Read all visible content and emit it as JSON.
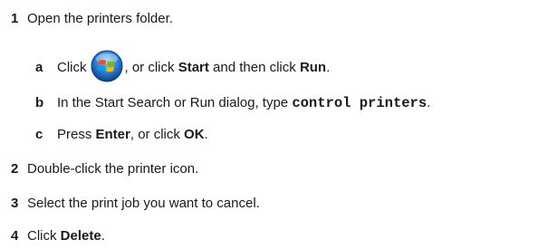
{
  "steps": [
    {
      "number": "1",
      "text": "Open the printers folder."
    },
    {
      "number": "2",
      "text": "Double-click the printer icon."
    },
    {
      "number": "3",
      "text": "Select the print job you want to cancel."
    },
    {
      "number": "4",
      "pre": "Click ",
      "bold": "Delete",
      "post": "."
    }
  ],
  "substeps": {
    "a": {
      "letter": "a",
      "pre": "Click",
      "mid": ", or click ",
      "start": "Start",
      "and": " and then click ",
      "run": "Run",
      "post": "."
    },
    "b": {
      "letter": "b",
      "pre": "In the Start Search or Run dialog, type ",
      "code": "control printers",
      "post": "."
    },
    "c": {
      "letter": "c",
      "pre": "Press ",
      "enter": "Enter",
      "mid": ", or click ",
      "ok": "OK",
      "post": "."
    }
  },
  "icons": {
    "start_button": "windows-start-orb-icon"
  }
}
